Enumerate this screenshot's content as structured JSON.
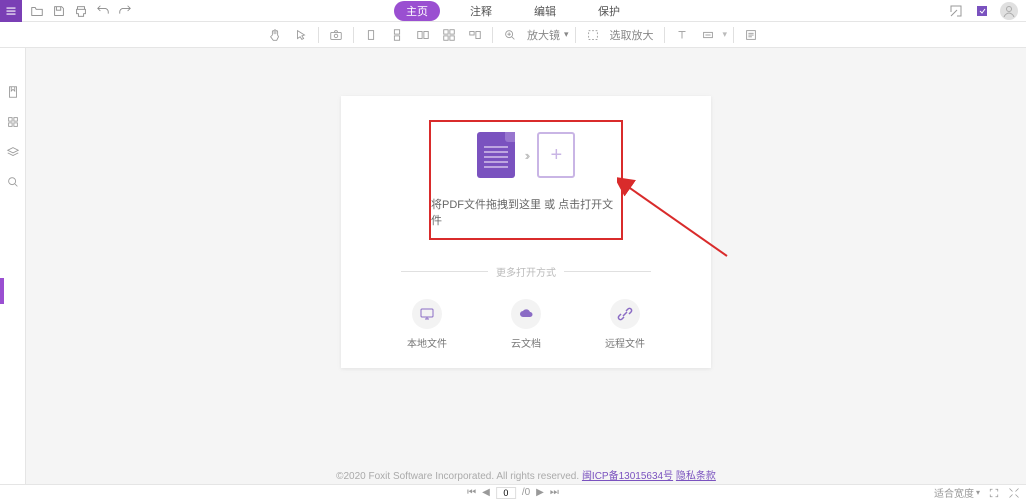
{
  "tabs": {
    "home": "主页",
    "comment": "注释",
    "edit": "编辑",
    "protect": "保护"
  },
  "toolbar": {
    "zoom_label": "放大镜",
    "select_zoom": "选取放大"
  },
  "dropzone": {
    "prefix": "将PDF文件拖拽到这里",
    "or": "或",
    "link": "点击打开文件"
  },
  "divider": "更多打开方式",
  "options": {
    "local": "本地文件",
    "cloud": "云文档",
    "remote": "远程文件"
  },
  "footer": {
    "copyright": "©2020 Foxit Software Incorporated. All rights reserved.",
    "icp": "闽ICP备13015634号",
    "privacy": "隐私条款"
  },
  "pager": {
    "page": "0",
    "total": "/0"
  },
  "bottom": {
    "fit": "适合宽度"
  }
}
